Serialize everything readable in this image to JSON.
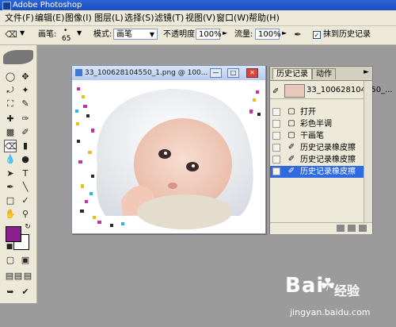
{
  "app": {
    "title": "Adobe Photoshop"
  },
  "menu": [
    "文件(F)",
    "编辑(E)",
    "图像(I)",
    "图层(L)",
    "选择(S)",
    "滤镜(T)",
    "视图(V)",
    "窗口(W)",
    "帮助(H)"
  ],
  "options": {
    "brush_label": "画笔:",
    "brush_size": "65",
    "mode_label": "模式:",
    "mode_value": "画笔",
    "opacity_label": "不透明度:",
    "opacity_value": "100%",
    "flow_label": "流量:",
    "flow_value": "100%",
    "erase_history_label": "抹到历史记录",
    "erase_history_checked": true
  },
  "document": {
    "title": "33_100628104550_1.png @ 100..."
  },
  "history_panel": {
    "tabs": [
      "历史记录",
      "动作"
    ],
    "snapshot_label": "33_100628104550_...",
    "items": [
      "打开",
      "彩色半调",
      "干画笔",
      "历史记录橡皮擦",
      "历史记录橡皮擦",
      "历史记录橡皮擦"
    ],
    "selected_index": 5
  },
  "watermark": {
    "brand": "Bai",
    "brand_sub": "经验",
    "url": "jingyan.baidu.com"
  },
  "colors": {
    "foreground": "#8a1f8f",
    "background": "#ffffff",
    "selection": "#2f6ae0",
    "title_bar": "#2d64d8"
  }
}
